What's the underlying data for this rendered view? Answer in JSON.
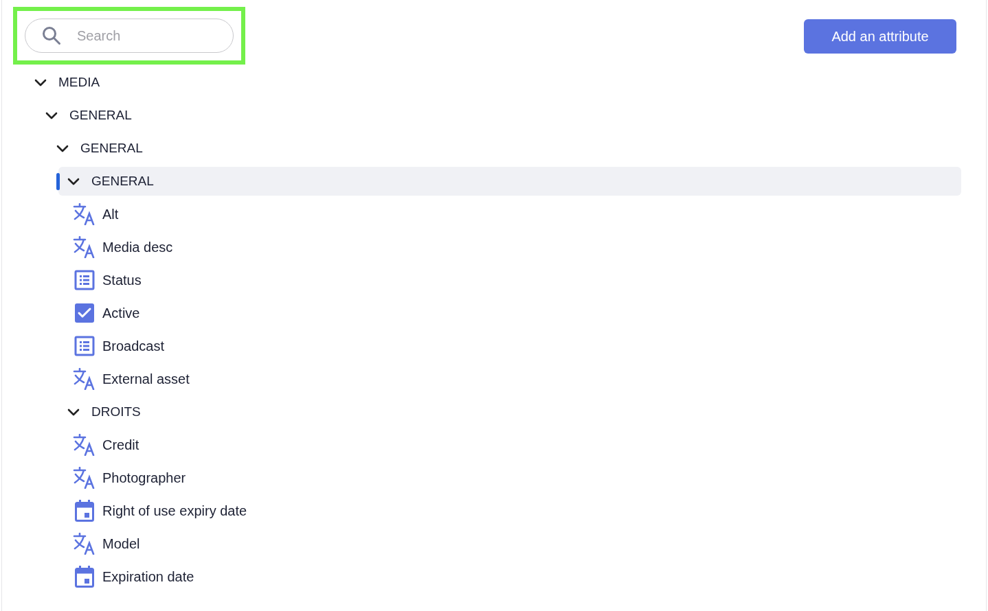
{
  "search": {
    "placeholder": "Search",
    "highlighted": true
  },
  "add_button": {
    "label": "Add an attribute"
  },
  "tree": [
    {
      "kind": "group",
      "label": "MEDIA",
      "expanded": true,
      "selected": false,
      "children": [
        {
          "kind": "group",
          "label": "GENERAL",
          "expanded": true,
          "selected": false,
          "children": [
            {
              "kind": "group",
              "label": "GENERAL",
              "expanded": true,
              "selected": false,
              "children": [
                {
                  "kind": "group",
                  "label": "GENERAL",
                  "expanded": true,
                  "selected": true,
                  "children": [
                    {
                      "kind": "text",
                      "label": "Alt"
                    },
                    {
                      "kind": "text",
                      "label": "Media desc"
                    },
                    {
                      "kind": "select",
                      "label": "Status"
                    },
                    {
                      "kind": "boolean",
                      "label": "Active"
                    },
                    {
                      "kind": "select",
                      "label": "Broadcast"
                    },
                    {
                      "kind": "text",
                      "label": "External asset"
                    }
                  ]
                },
                {
                  "kind": "group",
                  "label": "DROITS",
                  "expanded": true,
                  "selected": false,
                  "children": [
                    {
                      "kind": "text",
                      "label": "Credit"
                    },
                    {
                      "kind": "text",
                      "label": "Photographer"
                    },
                    {
                      "kind": "date",
                      "label": "Right of use expiry date"
                    },
                    {
                      "kind": "text",
                      "label": "Model"
                    },
                    {
                      "kind": "date",
                      "label": "Expiration date"
                    }
                  ]
                }
              ]
            }
          ]
        }
      ]
    }
  ]
}
